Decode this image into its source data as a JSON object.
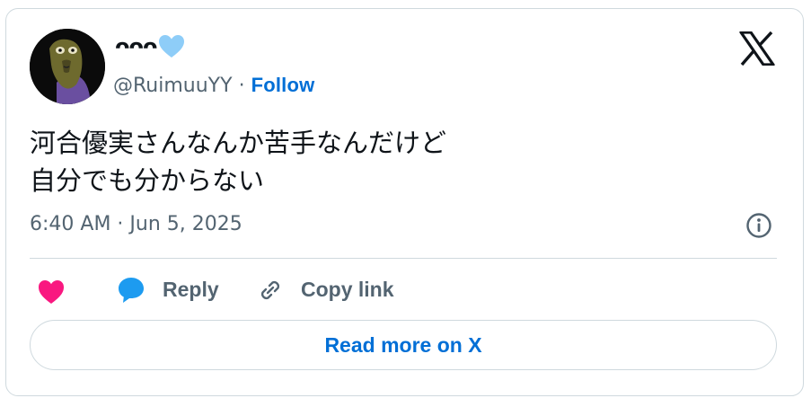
{
  "author": {
    "display_name": "ᴖᴖᴖ",
    "display_emoji": "light-blue-heart-icon",
    "handle": "@RuimuuYY",
    "separator": "·",
    "follow_label": "Follow"
  },
  "tweet": {
    "lines": [
      "河合優実さんなんか苦手なんだけど",
      "自分でも分からない"
    ],
    "timestamp": "6:40 AM · Jun 5, 2025"
  },
  "actions": {
    "like_icon": "heart-icon",
    "reply_icon": "speech-bubble-icon",
    "reply_label": "Reply",
    "copy_icon": "link-icon",
    "copy_label": "Copy link"
  },
  "cta": {
    "read_more_label": "Read more on X"
  },
  "colors": {
    "accent": "#006fd6",
    "like": "#f91880",
    "reply_bubble": "#1d9bf0",
    "muted_text": "#536471",
    "border": "#cfd9de",
    "emoji_heart": "#8ecdf8"
  }
}
